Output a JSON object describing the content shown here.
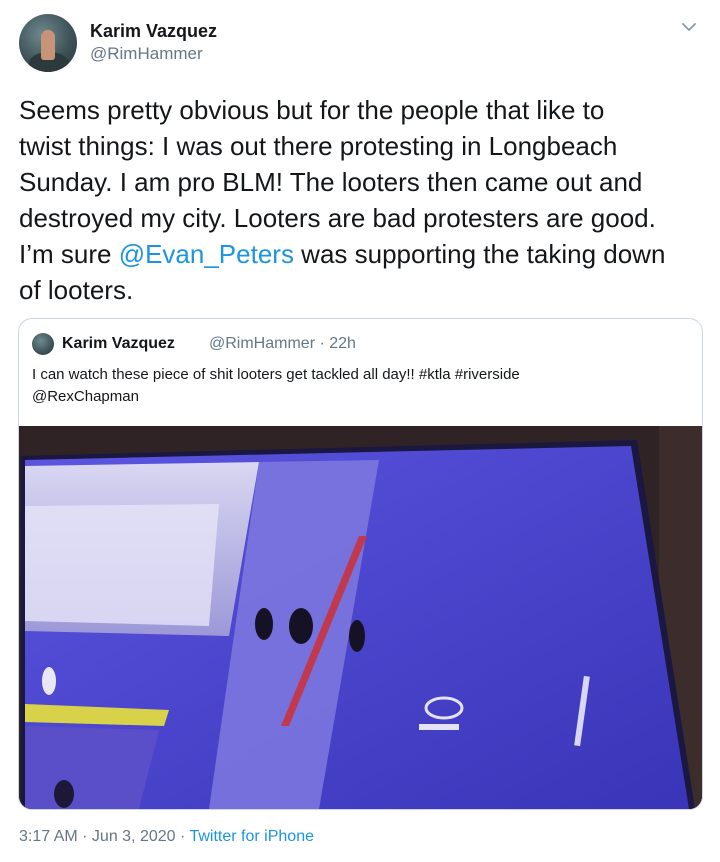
{
  "author": {
    "name": "Karim Vazquez",
    "handle": "@RimHammer"
  },
  "tweet": {
    "text_before": "Seems pretty obvious but for the people that like to\ntwist things: I was out there protesting in Longbeach\nSunday. I am pro BLM!  The looters then came out and\ndestroyed my city. Looters are bad protesters are good.\nI’m sure ",
    "mention": "@Evan_Peters",
    "text_after": " was supporting the taking down\nof looters."
  },
  "quoted_tweet": {
    "name": "Karim Vazquez",
    "handle": "@RimHammer",
    "time": "22h",
    "text": "I can watch these piece of shit looters get tackled all day!! #ktla #riverside\n@RexChapman"
  },
  "footer": {
    "time": "3:17 AM",
    "date": "Jun 3, 2020",
    "source": "Twitter for iPhone"
  },
  "colors": {
    "link": "#1b95e0",
    "secondary_text": "#657786",
    "border": "#ccd6dd"
  },
  "icons": {
    "caret": "chevron-down-icon"
  }
}
